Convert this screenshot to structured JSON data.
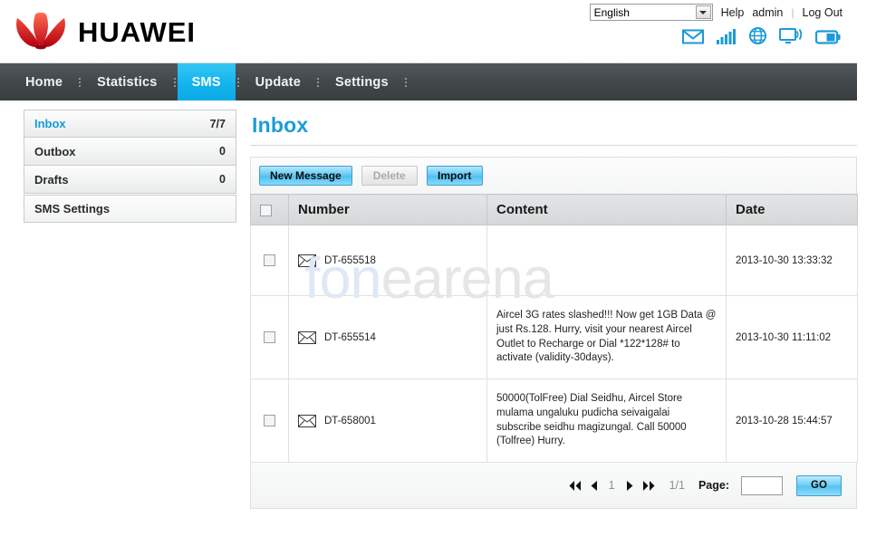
{
  "brand": {
    "name": "HUAWEI",
    "logo_icon": "huawei-flower-logo"
  },
  "topbar": {
    "language": {
      "selected": "English",
      "icon": "chevron-down-icon"
    },
    "help_label": "Help",
    "user_label": "admin",
    "logout_label": "Log Out",
    "separator": "|",
    "status_icons": [
      {
        "name": "message-status-icon",
        "title": "Message"
      },
      {
        "name": "signal-bars-status-icon",
        "title": "Signal"
      },
      {
        "name": "globe-network-status-icon",
        "title": "Network"
      },
      {
        "name": "wlan-monitor-status-icon",
        "title": "WLAN"
      },
      {
        "name": "battery-status-icon",
        "title": "Battery"
      }
    ]
  },
  "nav": {
    "items": [
      {
        "label": "Home",
        "active": false
      },
      {
        "label": "Statistics",
        "active": false
      },
      {
        "label": "SMS",
        "active": true
      },
      {
        "label": "Update",
        "active": false
      },
      {
        "label": "Settings",
        "active": false
      }
    ],
    "active_color": "#12b2ec",
    "bar_color": "#414749"
  },
  "sidebar": {
    "items": [
      {
        "label": "Inbox",
        "count": "7/7",
        "selected": true
      },
      {
        "label": "Outbox",
        "count": "0",
        "selected": false
      },
      {
        "label": "Drafts",
        "count": "0",
        "selected": false
      },
      {
        "label": "SMS Settings",
        "count": "",
        "selected": false
      }
    ]
  },
  "main": {
    "title": "Inbox",
    "title_color": "#1b9dd9",
    "toolbar": {
      "new_message_label": "New Message",
      "delete_label": "Delete",
      "import_label": "Import"
    },
    "table": {
      "columns": [
        "",
        "Number",
        "Content",
        "Date"
      ],
      "rows": [
        {
          "icon": "envelope-icon",
          "number": "DT-655518",
          "content": "",
          "date": "2013-10-30 13:33:32"
        },
        {
          "icon": "envelope-icon",
          "number": "DT-655514",
          "content": "Aircel 3G rates slashed!!! Now get 1GB Data @ just Rs.128. Hurry, visit your nearest Aircel Outlet to Recharge or Dial *122*128# to activate (validity-30days).",
          "date": "2013-10-30 11:11:02"
        },
        {
          "icon": "envelope-icon",
          "number": "DT-658001",
          "content": "50000(TolFree) Dial Seidhu, Aircel Store mulama ungaluku pudicha seivaigalai subscribe seidhu magizungal. Call 50000 (Tolfree) Hurry.",
          "date": "2013-10-28 15:44:57"
        }
      ]
    },
    "pagination": {
      "first_icon": "double-left-arrow-icon",
      "prev_icon": "left-arrow-icon",
      "current_page": "1",
      "next_icon": "right-arrow-icon",
      "last_icon": "double-right-arrow-icon",
      "range": "1/1",
      "page_label": "Page:",
      "page_value": "",
      "go_label": "GO"
    }
  },
  "watermark": {
    "part1": "fon",
    "part2": "earena"
  }
}
